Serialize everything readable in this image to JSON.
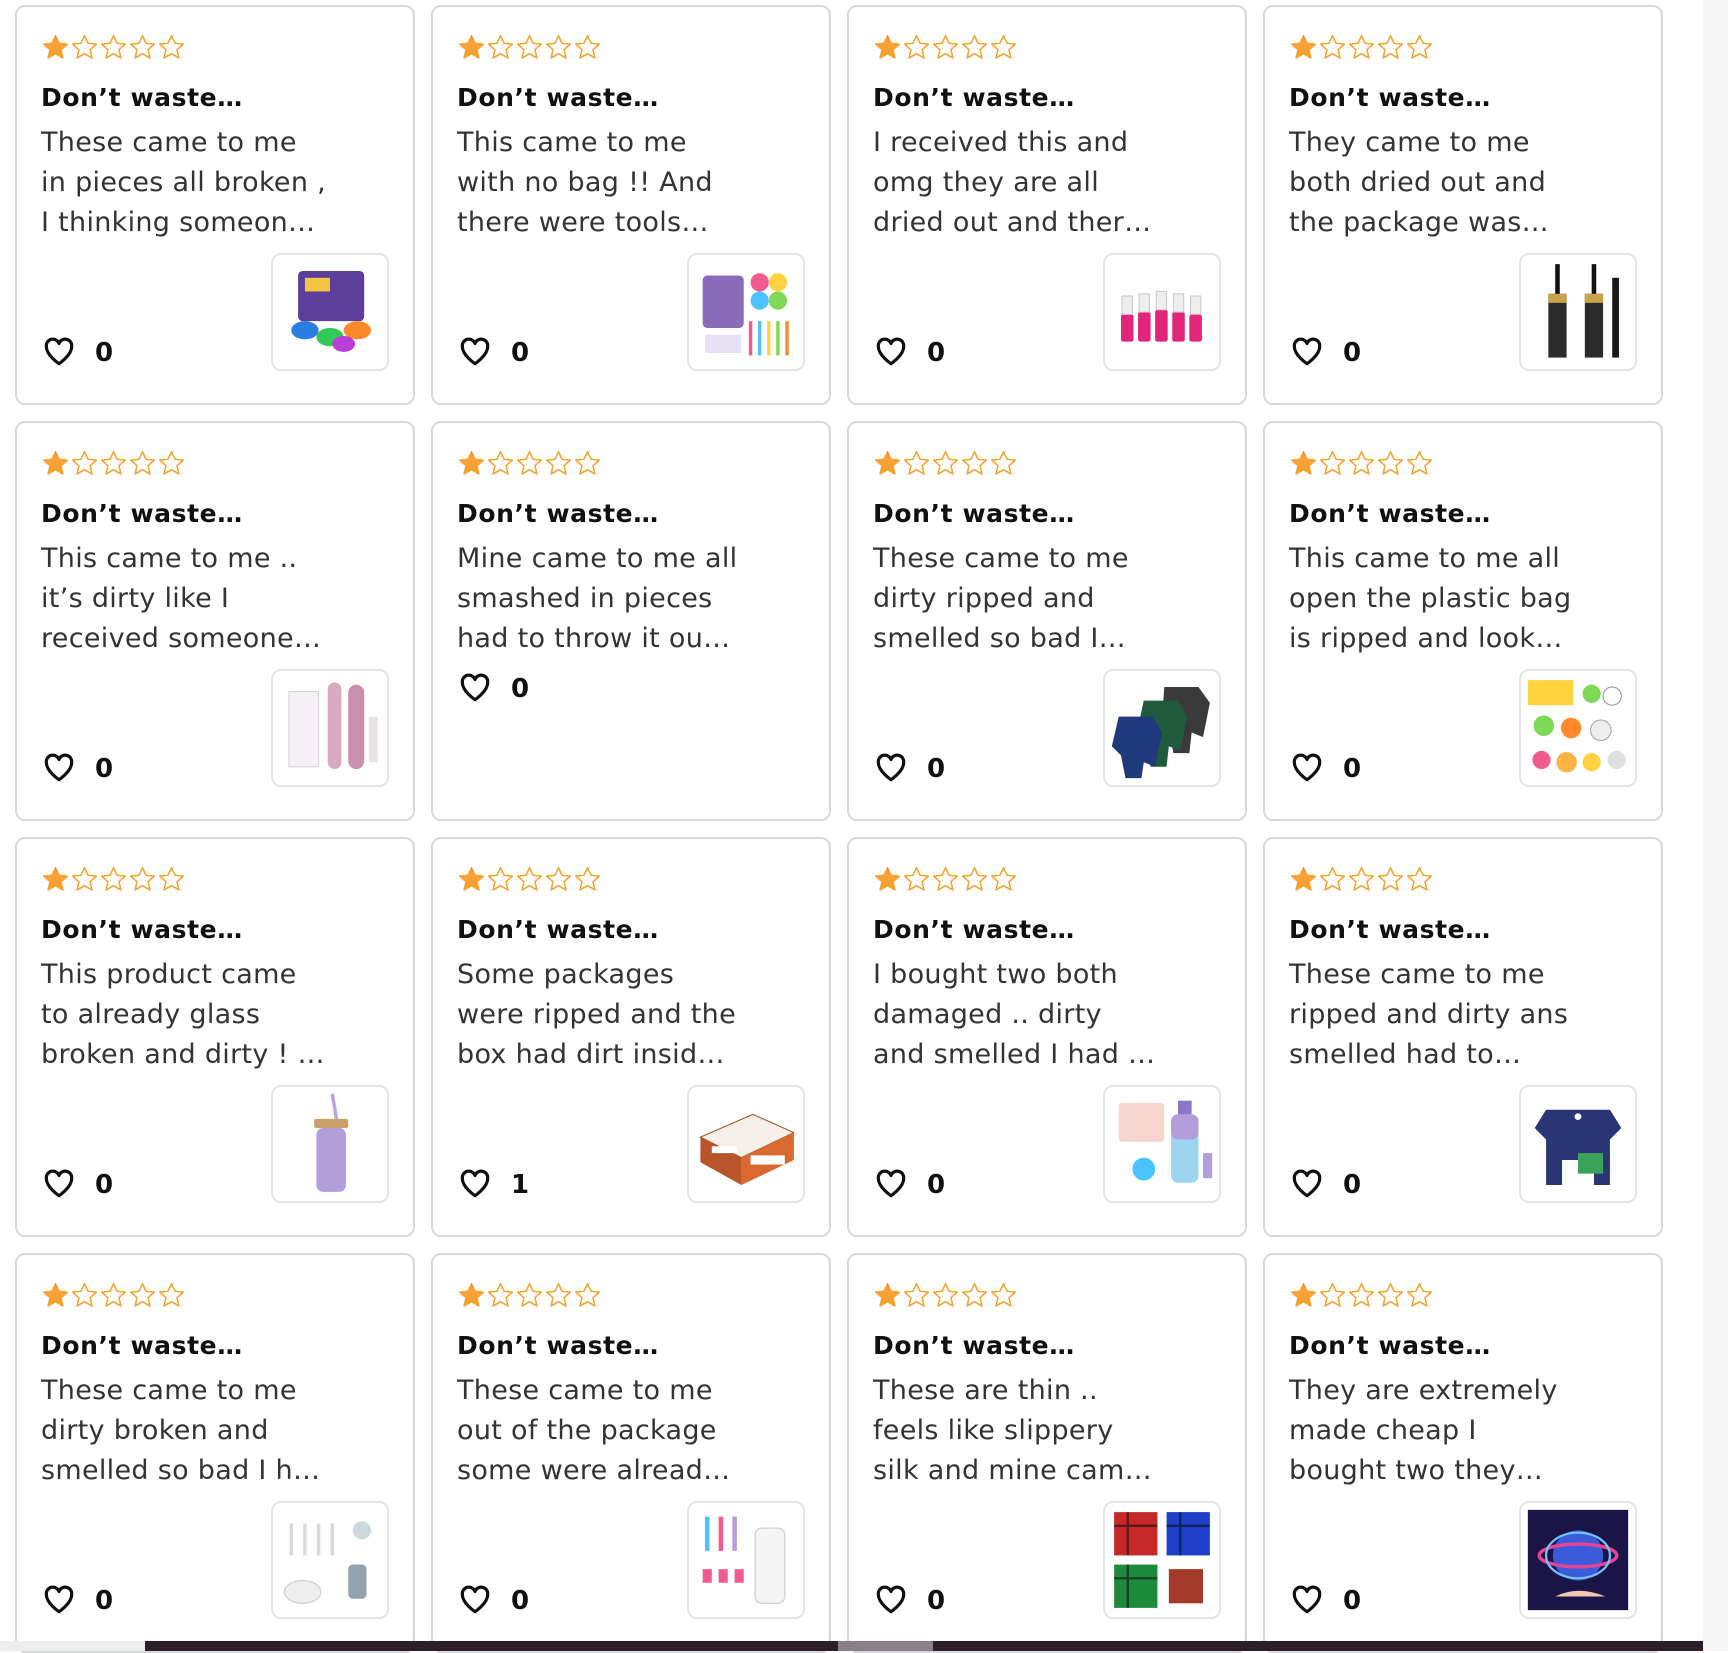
{
  "accent": {
    "star": "#f7a233",
    "card_border": "#d5d9d9"
  },
  "icons": {
    "rating": "star-icon",
    "like": "heart-icon"
  },
  "reviews": [
    {
      "rating": 1,
      "title": "Don’t waste…",
      "lines": [
        "These came to me",
        "in pieces all broken ,",
        "I thinking someon…"
      ],
      "likes": "0",
      "thumb": "talking-buttons-product-thumbnail"
    },
    {
      "rating": 1,
      "title": "Don’t waste…",
      "lines": [
        "This came to me",
        "with no bag !! And",
        "there were tools…"
      ],
      "likes": "0",
      "thumb": "craft-kit-product-thumbnail"
    },
    {
      "rating": 1,
      "title": "Don’t waste…",
      "lines": [
        "I received this and",
        "omg they are all",
        "dried out and ther…"
      ],
      "likes": "0",
      "thumb": "nail-polish-product-thumbnail"
    },
    {
      "rating": 1,
      "title": "Don’t waste…",
      "lines": [
        "They came to me",
        "both dried out and",
        "the package was…"
      ],
      "likes": "0",
      "thumb": "mascara-product-thumbnail"
    },
    {
      "rating": 1,
      "title": "Don’t waste…",
      "lines": [
        "This came to me ..",
        "it’s dirty like I",
        "received someone…"
      ],
      "likes": "0",
      "thumb": "trimmer-product-thumbnail"
    },
    {
      "rating": 1,
      "title": "Don’t waste…",
      "lines": [
        "Mine came to me all",
        "smashed in pieces",
        "had to throw it ou…"
      ],
      "likes": "0",
      "thumb": null
    },
    {
      "rating": 1,
      "title": "Don’t waste…",
      "lines": [
        "These came to me",
        "dirty ripped and",
        "smelled so bad I…"
      ],
      "likes": "0",
      "thumb": "dog-pajamas-product-thumbnail"
    },
    {
      "rating": 1,
      "title": "Don’t waste…",
      "lines": [
        "This came to me all",
        "open the plastic bag",
        "is ripped and look…"
      ],
      "likes": "0",
      "thumb": "stickers-product-thumbnail"
    },
    {
      "rating": 1,
      "title": "Don’t waste…",
      "lines": [
        "This product came",
        "to already glass",
        "broken and dirty ! …"
      ],
      "likes": "0",
      "thumb": "tumbler-product-thumbnail"
    },
    {
      "rating": 1,
      "title": "Don’t waste…",
      "lines": [
        "Some packages",
        "were ripped and the",
        "box had dirt insid…"
      ],
      "likes": "1",
      "thumb": "snack-box-product-thumbnail"
    },
    {
      "rating": 1,
      "title": "Don’t waste…",
      "lines": [
        "I bought two both",
        "damaged .. dirty",
        "and smelled I had …"
      ],
      "likes": "0",
      "thumb": "water-bottle-product-thumbnail"
    },
    {
      "rating": 1,
      "title": "Don’t waste…",
      "lines": [
        "These came to me",
        "ripped and dirty ans",
        "smelled had to…"
      ],
      "likes": "0",
      "thumb": "dog-shirt-product-thumbnail"
    },
    {
      "rating": 1,
      "title": "Don’t waste…",
      "lines": [
        "These came to me",
        "dirty broken and",
        "smelled so bad I h…"
      ],
      "likes": "0",
      "thumb": "straw-set-product-thumbnail"
    },
    {
      "rating": 1,
      "title": "Don’t waste…",
      "lines": [
        "These came to me",
        "out of the package",
        "some were alread…"
      ],
      "likes": "0",
      "thumb": "straw-toppers-product-thumbnail"
    },
    {
      "rating": 1,
      "title": "Don’t waste…",
      "lines": [
        "These are thin ..",
        "feels like slippery",
        "silk and mine cam…"
      ],
      "likes": "0",
      "thumb": "plaid-pajamas-product-thumbnail"
    },
    {
      "rating": 1,
      "title": "Don’t waste…",
      "lines": [
        "They are extremely",
        "made cheap I",
        "bought two they…"
      ],
      "likes": "0",
      "thumb": "flying-orb-product-thumbnail"
    }
  ]
}
